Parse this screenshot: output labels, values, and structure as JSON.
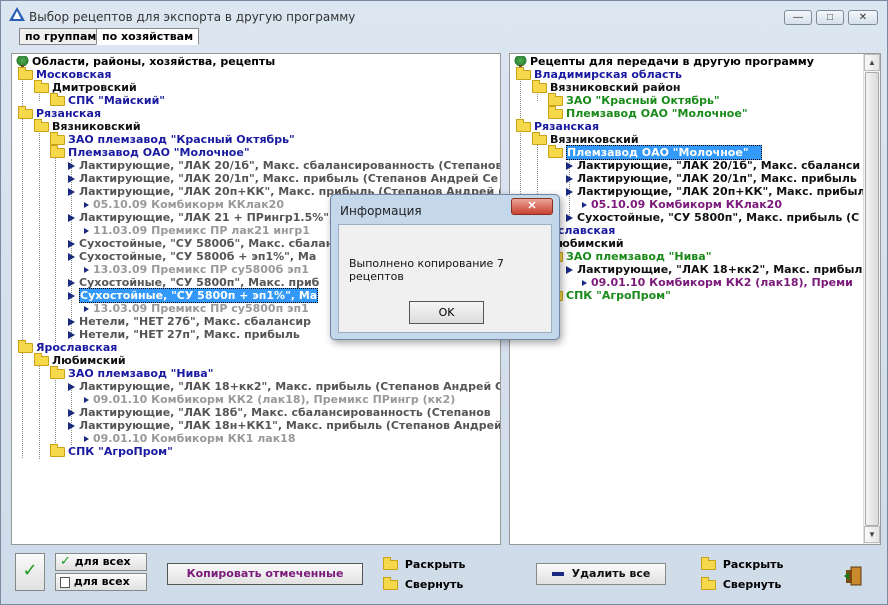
{
  "window": {
    "title": "Выбор рецептов для экспорта в другую программу",
    "minimize": "—",
    "maximize": "□",
    "close": "✕"
  },
  "tabs": [
    {
      "label": "по группам"
    },
    {
      "label": "по хозяйствам"
    }
  ],
  "left_panel": {
    "header": "Области, районы, хозяйства, рецепты",
    "rows": [
      "Московская",
      "Дмитровский",
      "СПК \"Майский\"",
      "Рязанская",
      "Вязниковский",
      "ЗАО племзавод \"Красный Октябрь\"",
      "Племзавод ОАО \"Молочное\"",
      "Лактирующие, \"ЛАК 20/1б\", Макс. сбалансированность (Степанов Андрей Се",
      "Лактирующие, \"ЛАК 20/1п\", Макс. прибыль (Степанов Андрей Се",
      "Лактирующие, \"ЛАК 20п+КК\", Макс. прибыль (Степанов Андрей (",
      "05.10.09   Комбикорм ККлак20",
      "Лактирующие, \"ЛАК 21 + ПРингр1.5%\", Ма",
      "11.03.09   Премикс ПР лак21 ингр1",
      "Сухостойные, \"СУ 5800б\", Макс. сбалан",
      "Сухостойные, \"СУ 5800б + эп1%\", Ма",
      "13.03.09   Премикс ПР су5800б эп1",
      "Сухостойные, \"СУ 5800п\", Макс. приб",
      "Сухостойные, \"СУ 5800п + эп1%\", Ма",
      "13.03.09   Премикс ПР су5800п эп1",
      "Нетели, \"НЕТ 27б\", Макс. сбалансир",
      "Нетели, \"НЕТ 27п\", Макс. прибыль",
      "Ярославская",
      "Любимский",
      "ЗАО племзавод \"Нива\"",
      "Лактирующие, \"ЛАК 18+кк2\", Макс. прибыль (Степанов Андрей С",
      "09.01.10   Комбикорм КК2 (лак18), Премикс ПРингр (кк2)",
      "Лактирующие, \"ЛАК 18б\", Макс. сбалансированность (Степанов",
      "Лактирующие, \"ЛАК 18н+КК1\", Макс. прибыль (Степанов Андрей",
      "09.01.10   Комбикорм КК1 лак18",
      "СПК \"АгроПром\""
    ]
  },
  "right_panel": {
    "header": "Рецепты для передачи в другую программу",
    "rows": [
      "Владимирская область",
      "Вязниковский район",
      "ЗАО \"Красный Октябрь\"",
      "Племзавод ОАО \"Молочное\"",
      "Рязанская",
      "Вязниковский",
      "Племзавод ОАО \"Молочное\"",
      "Лактирующие, \"ЛАК 20/1б\", Макс. сбаланси",
      "Лактирующие, \"ЛАК 20/1п\", Макс. прибыль",
      "Лактирующие, \"ЛАК 20п+КК\", Макс. прибыль",
      "05.10.09   Комбикорм ККлак20",
      "Сухостойные, \"СУ 5800п\", Макс. прибыль (С",
      "Ярославская",
      "Любимский",
      "ЗАО племзавод \"Нива\"",
      "Лактирующие, \"ЛАК 18+кк2\", Макс. прибыль",
      "09.01.10   Комбикорм КК2 (лак18), Преми",
      "СПК \"АгроПром\""
    ]
  },
  "dialog": {
    "title": "Информация",
    "close": "✕",
    "message": "Выполнено копирование 7 рецептов",
    "ok": "OK"
  },
  "bottom": {
    "check_all": "для всех",
    "uncheck_all": "для всех",
    "copy_button": "Копировать отмеченные",
    "expand_left": "Раскрыть",
    "collapse_left": "Свернуть",
    "delete_all": "Удалить все",
    "expand_right": "Раскрыть",
    "collapse_right": "Свернуть"
  },
  "colors": {
    "accent": "#3399ff",
    "region": "#1a1aa0",
    "farm_green": "#1a8a1a",
    "item_purple": "#7a1a7a",
    "dialog_close": "#c8422e"
  }
}
